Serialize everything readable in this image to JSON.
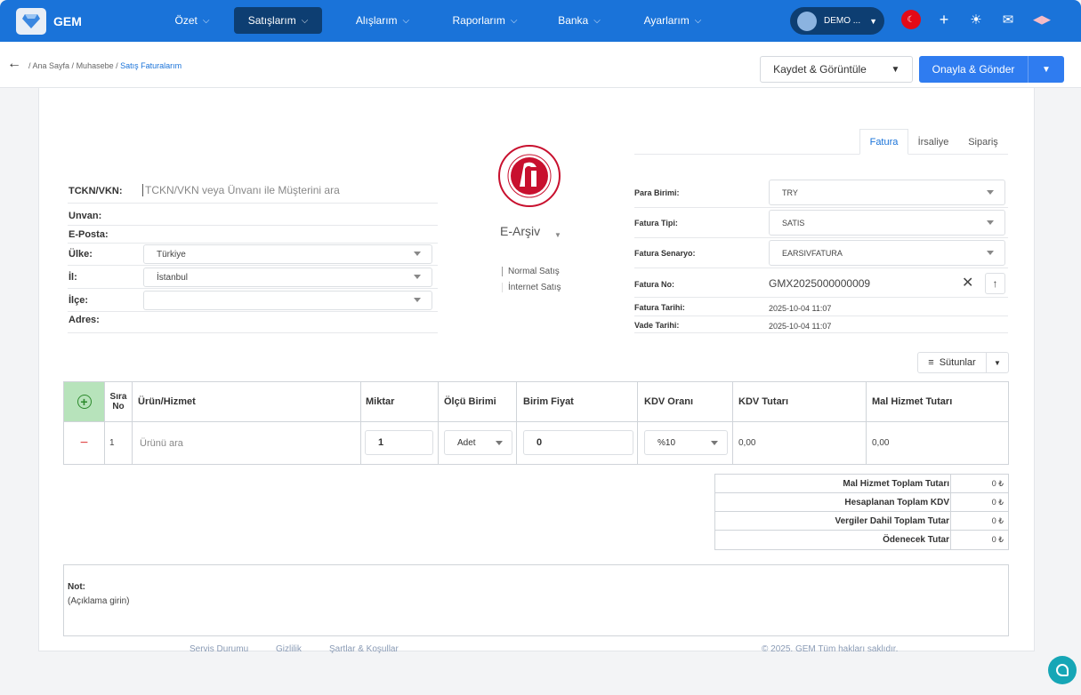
{
  "brand": {
    "name": "GEM"
  },
  "nav": [
    {
      "label": "Özet"
    },
    {
      "label": "Satışlarım"
    },
    {
      "label": "Alışlarım"
    },
    {
      "label": "Raporlarım"
    },
    {
      "label": "Banka"
    },
    {
      "label": "Ayarlarım"
    }
  ],
  "user": {
    "label": "DEMO ..."
  },
  "breadcrumb": {
    "home": "Ana Sayfa /",
    "section": "Muhasebe /",
    "current": "Satış Faturalarım"
  },
  "actions": {
    "save": "Kaydet & Görüntüle",
    "approve": "Onayla & Gönder"
  },
  "customer": {
    "tckn_label": "TCKN/VKN:",
    "search_placeholder": "TCKN/VKN veya Ünvanı ile Müşterini ara",
    "unvan_label": "Unvan:",
    "eposta_label": "E-Posta:",
    "ulke_label": "Ülke:",
    "ulke_value": "Türkiye",
    "il_label": "İl:",
    "il_value": "İstanbul",
    "ilce_label": "İlçe:",
    "ilce_value": "",
    "adres_label": "Adres:"
  },
  "invoice_kind": {
    "label": "E-Arşiv",
    "options": [
      "Normal Satış",
      "İnternet Satış"
    ]
  },
  "tabs": [
    "Fatura",
    "İrsaliye",
    "Sipariş"
  ],
  "invoice": {
    "para_label": "Para Birimi:",
    "para_value": "TRY",
    "tip_label": "Fatura Tipi:",
    "tip_value": "SATIS",
    "senaryo_label": "Fatura Senaryo:",
    "senaryo_value": "EARSIVFATURA",
    "no_label": "Fatura No:",
    "no_value": "GMX2025000000009",
    "tarih_label": "Fatura Tarihi:",
    "tarih_value": "2025-10-04 11:07",
    "vade_label": "Vade Tarihi:",
    "vade_value": "2025-10-04 11:07"
  },
  "columns_button": "Sütunlar",
  "table": {
    "headers": [
      "Sıra No",
      "Ürün/Hizmet",
      "Miktar",
      "Ölçü Birimi",
      "Birim Fiyat",
      "KDV Oranı",
      "KDV Tutarı",
      "Mal Hizmet Tutarı"
    ],
    "row": {
      "sira": "1",
      "urun_placeholder": "Ürünü ara",
      "miktar": "1",
      "birim": "Adet",
      "fiyat": "0",
      "kdv_orani": "%10",
      "kdv_tutari": "0,00",
      "mal_tutari": "0,00"
    }
  },
  "totals": [
    {
      "label": "Mal Hizmet Toplam Tutarı",
      "value": "0 ₺"
    },
    {
      "label": "Hesaplanan Toplam KDV",
      "value": "0 ₺"
    },
    {
      "label": "Vergiler Dahil Toplam Tutar",
      "value": "0 ₺"
    },
    {
      "label": "Ödenecek Tutar",
      "value": "0 ₺"
    }
  ],
  "note": {
    "label": "Not:",
    "text": "(Açıklama girin)"
  },
  "footer": {
    "service": "Servis Durumu",
    "stats": "Gizlilik",
    "terms": "Şartlar & Koşullar",
    "copyright": "© 2025. GEM Tüm hakları saklıdır."
  },
  "colors": {
    "primary": "#1a73d9",
    "nav_active": "#0d3e72",
    "button": "#2f7cf0",
    "add_green": "#2c8a2c",
    "remove_red": "#e04848",
    "chat": "#16a6b6"
  }
}
